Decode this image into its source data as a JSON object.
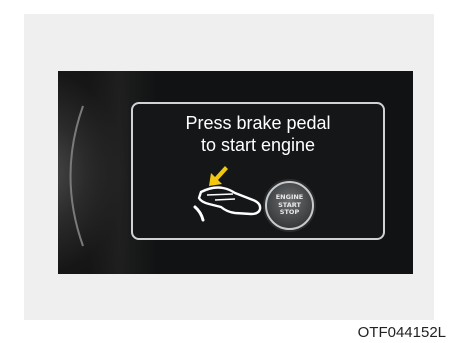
{
  "message": {
    "line1": "Press brake pedal",
    "line2": "to start engine"
  },
  "button": {
    "line1": "ENGINE",
    "line2": "START",
    "line3": "STOP"
  },
  "figure_code": "OTF044152L",
  "icons": {
    "arrow": "arrow-icon",
    "foot": "foot-on-pedal-icon",
    "button": "engine-start-stop-button-icon"
  },
  "colors": {
    "arrow": "#f2c70f",
    "screen": "#111213",
    "text": "#ffffff"
  }
}
